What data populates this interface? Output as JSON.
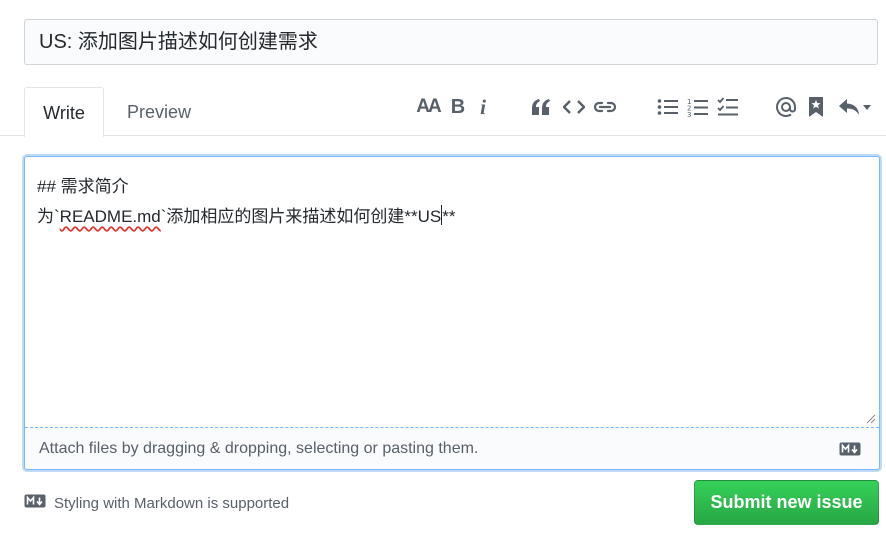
{
  "issue_title": {
    "value": "US: 添加图片描述如何创建需求"
  },
  "tabs": {
    "write": "Write",
    "preview": "Preview"
  },
  "toolbar": {
    "header_text": "AA",
    "bold": "B",
    "italic": "i"
  },
  "editor": {
    "line1": "## 需求简介",
    "line2_prefix": "为`",
    "line2_misspelled": "README.md",
    "line2_middle": "`添加相应的图片来描述如何创建**US",
    "line2_suffix": "**"
  },
  "attach": {
    "label": "Attach files by dragging & dropping, selecting or pasting them."
  },
  "footer": {
    "markdown_note": "Styling with Markdown is supported"
  },
  "actions": {
    "submit_label": "Submit new issue"
  },
  "colors": {
    "accent": "#0366d6",
    "submit_green": "#2ea44f",
    "icon_grey": "#586069",
    "spellcheck_red": "#e0342c"
  },
  "icons": [
    "header-icon",
    "bold-icon",
    "italic-icon",
    "quote-icon",
    "code-icon",
    "link-icon",
    "unordered-list-icon",
    "ordered-list-icon",
    "task-list-icon",
    "mention-icon",
    "saved-reply-icon",
    "reply-dropdown-icon",
    "markdown-icon"
  ]
}
